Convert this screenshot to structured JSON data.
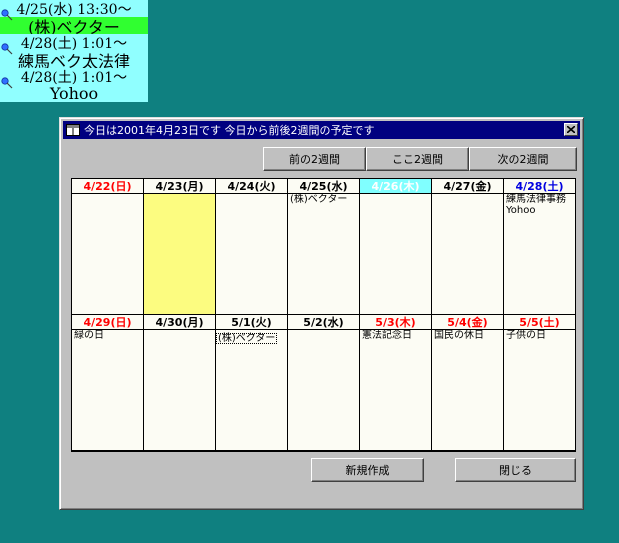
{
  "desktop_notes": [
    {
      "time": "4/25(水)  13:30〜",
      "title": "(株)ベクター",
      "bg_time": "#90ffff",
      "bg_title": "#30ff30"
    },
    {
      "time": "4/28(土)  1:01〜",
      "title": "練馬ベク太法律",
      "bg_time": "#90ffff",
      "bg_title": "#90ffff"
    },
    {
      "time": "4/28(土)  1:01〜",
      "title": "Yohoo",
      "bg_time": "#90ffff",
      "bg_title": "#90ffff"
    }
  ],
  "window": {
    "title": "今日は2001年4月23日です  今日から前後2週間の予定です"
  },
  "nav": {
    "prev": "前の2週間",
    "current": "ここ2週間",
    "next": "次の2週間"
  },
  "footer": {
    "new": "新規作成",
    "close": "閉じる"
  },
  "weeks": [
    {
      "days": [
        {
          "label": "4/22(日)",
          "kind": "sun",
          "events": []
        },
        {
          "label": "4/23(月)",
          "kind": "wkd",
          "today": true,
          "events": []
        },
        {
          "label": "4/24(火)",
          "kind": "wkd",
          "events": []
        },
        {
          "label": "4/25(水)",
          "kind": "wkd",
          "events": [
            "(株)ベクター"
          ]
        },
        {
          "label": "4/26(木)",
          "kind": "sel",
          "events": []
        },
        {
          "label": "4/27(金)",
          "kind": "wkd",
          "events": []
        },
        {
          "label": "4/28(土)",
          "kind": "sat",
          "events": [
            "練馬法律事務",
            "Yohoo"
          ]
        }
      ]
    },
    {
      "days": [
        {
          "label": "4/29(日)",
          "kind": "sun",
          "events": [
            "緑の日"
          ]
        },
        {
          "label": "4/30(月)",
          "kind": "wkd",
          "events": []
        },
        {
          "label": "5/1(火)",
          "kind": "wkd",
          "events": [
            "(株)ベクター"
          ],
          "dotted": true
        },
        {
          "label": "5/2(水)",
          "kind": "wkd",
          "events": []
        },
        {
          "label": "5/3(木)",
          "kind": "hol",
          "events": [
            "憲法記念日"
          ]
        },
        {
          "label": "5/4(金)",
          "kind": "hol",
          "events": [
            "国民の休日"
          ]
        },
        {
          "label": "5/5(土)",
          "kind": "hol",
          "events": [
            "子供の日"
          ]
        }
      ]
    }
  ]
}
